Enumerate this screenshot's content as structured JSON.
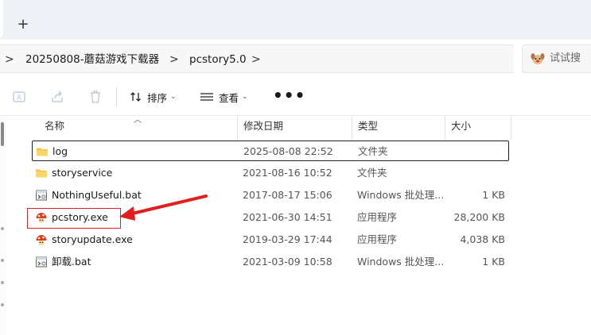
{
  "tabs": {
    "new_tab": "+"
  },
  "breadcrumb": {
    "items": [
      "20250808-蘑菇游戏下载器",
      "pcstory5.0"
    ],
    "separator": ">"
  },
  "search": {
    "label": "试试搜"
  },
  "toolbar": {
    "sort_label": "排序",
    "view_label": "查看",
    "more_label": "•••"
  },
  "columns": {
    "name": "名称",
    "date": "修改日期",
    "type": "类型",
    "size": "大小"
  },
  "files": [
    {
      "name": "log",
      "date": "2025-08-08 22:52",
      "type": "文件夹",
      "size": "",
      "icon": "folder-icon"
    },
    {
      "name": "storyservice",
      "date": "2021-08-16 10:52",
      "type": "文件夹",
      "size": "",
      "icon": "folder-icon"
    },
    {
      "name": "NothingUseful.bat",
      "date": "2017-08-17 15:06",
      "type": "Windows 批处理...",
      "size": "1 KB",
      "icon": "batch-file-icon"
    },
    {
      "name": "pcstory.exe",
      "date": "2021-06-30 14:51",
      "type": "应用程序",
      "size": "28,200 KB",
      "icon": "mushroom-app-icon"
    },
    {
      "name": "storyupdate.exe",
      "date": "2019-03-29 17:44",
      "type": "应用程序",
      "size": "4,038 KB",
      "icon": "mushroom-app-icon"
    },
    {
      "name": "卸载.bat",
      "date": "2021-03-09 10:58",
      "type": "Windows 批处理...",
      "size": "1 KB",
      "icon": "batch-file-icon"
    }
  ],
  "colors": {
    "annotation": "#e02020",
    "folder": "#f5c542"
  }
}
